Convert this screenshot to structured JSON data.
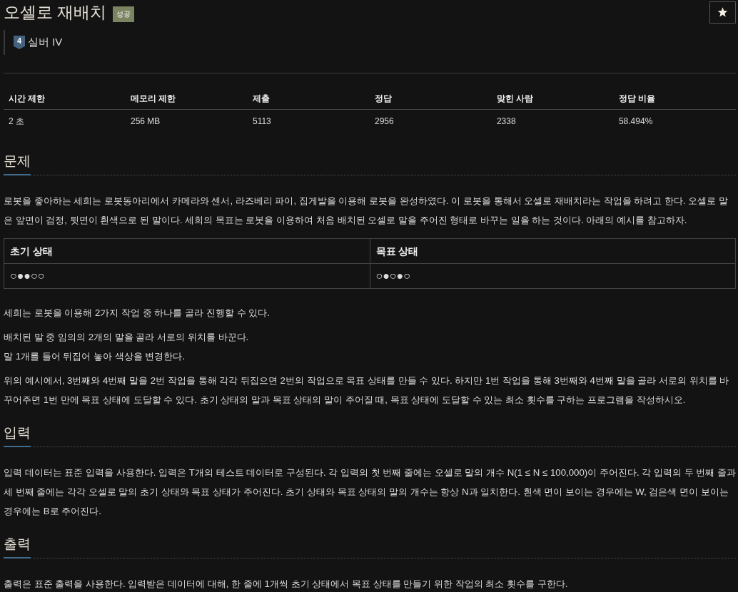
{
  "problem": {
    "title": "오셀로 재배치",
    "status_badge": "성공",
    "tier": {
      "number": "4",
      "name": "실버 IV"
    }
  },
  "stats_table": {
    "columns": [
      "시간 제한",
      "메모리 제한",
      "제출",
      "정답",
      "맞힌 사람",
      "정답 비율"
    ],
    "rows": [
      [
        "2 초",
        "256 MB",
        "5113",
        "2956",
        "2338",
        "58.494%"
      ]
    ]
  },
  "sections": [
    {
      "heading": "문제",
      "blocks": [
        {
          "kind": "paragraph",
          "text": "로봇을 좋아하는 세희는 로봇동아리에서 카메라와 센서, 라즈베리 파이, 집게발을 이용해 로봇을 완성하였다. 이 로봇을 통해서 오셀로 재배치라는 작업을 하려고 한다. 오셀로 말은 앞면이 검정, 뒷면이 흰색으로 된 말이다. 세희의 목표는 로봇을 이용하여 처음 배치된 오셀로 말을 주어진 형태로 바꾸는 일을 하는 것이다. 아래의 예시를 참고하자."
        },
        {
          "kind": "table",
          "columns": [
            "초기 상태",
            "목표 상태"
          ],
          "rows": [
            [
              "○●●○○",
              "○●○●○"
            ]
          ]
        },
        {
          "kind": "paragraph",
          "text": "세희는 로봇을 이용해 2가지 작업 중 하나를 골라 진행할 수 있다."
        },
        {
          "kind": "list",
          "items": [
            "배치된 말 중 임의의 2개의 말을 골라 서로의 위치를 바꾼다.",
            "말 1개를 들어 뒤집어 놓아 색상을 변경한다."
          ]
        },
        {
          "kind": "paragraph",
          "text": "위의 예시에서, 3번째와 4번째 말을 2번 작업을 통해 각각 뒤집으면 2번의 작업으로 목표 상태를 만들 수 있다. 하지만 1번 작업을 통해 3번째와 4번째 말을 골라 서로의 위치를 바꾸어주면 1번 만에 목표 상태에 도달할 수 있다. 초기 상태의 말과 목표 상태의 말이 주어질 때, 목표 상태에 도달할 수 있는 최소 횟수를 구하는 프로그램을 작성하시오."
        }
      ]
    },
    {
      "heading": "입력",
      "blocks": [
        {
          "kind": "paragraph",
          "text": "입력 데이터는 표준 입력을 사용한다. 입력은 T개의 테스트 데이터로 구성된다. 각 입력의 첫 번째 줄에는 오셀로 말의 개수 N(1 ≤ N ≤ 100,000)이 주어진다. 각 입력의 두 번째 줄과 세 번째 줄에는 각각 오셀로 말의 초기 상태와 목표 상태가 주어진다. 초기 상태와 목표 상태의 말의 개수는 항상 N과 일치한다. 흰색 면이 보이는 경우에는 W, 검은색 면이 보이는 경우에는 B로 주어진다."
        }
      ]
    },
    {
      "heading": "출력",
      "blocks": [
        {
          "kind": "paragraph",
          "text": "출력은 표준 출력을 사용한다. 입력받은 데이터에 대해, 한 줄에 1개씩 초기 상태에서 목표 상태를 만들기 위한 작업의 최소 횟수를 구한다."
        }
      ]
    }
  ]
}
